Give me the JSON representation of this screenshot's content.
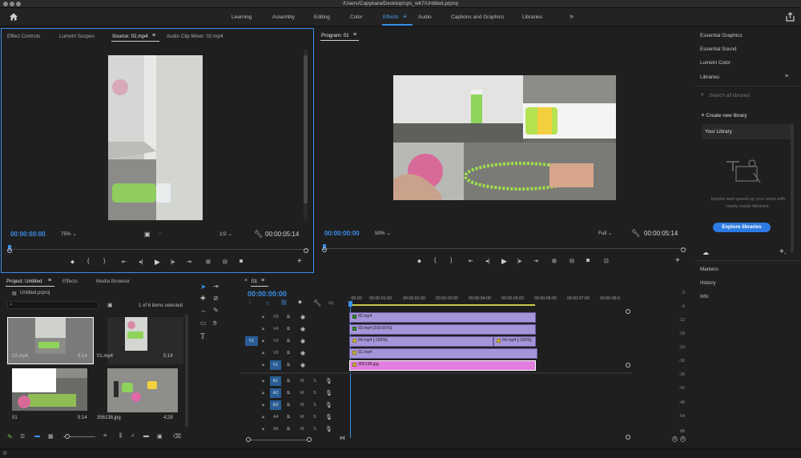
{
  "window": {
    "title": "/Users/Capybara/Desktop/cps_wk7/Untitled.prproj"
  },
  "workspaces": [
    "Learning",
    "Assembly",
    "Editing",
    "Color",
    "Effects",
    "Audio",
    "Captions and Graphics",
    "Libraries"
  ],
  "workspace_active": "Effects",
  "source_panel": {
    "tabs": [
      "Effect Controls",
      "Lumetri Scopes",
      "Source: 02.mp4",
      "Audio Clip Mixer: 02.mp4"
    ],
    "active_tab": "Source: 02.mp4",
    "timecode_in": "00:00:00:00",
    "zoom": "75%",
    "resolution": "1/2",
    "duration": "00:00:05:14"
  },
  "program_panel": {
    "title": "Program: 01",
    "timecode_in": "00:00:00:00",
    "zoom": "50%",
    "resolution": "Full",
    "duration": "00:00:05:14"
  },
  "right_panel": {
    "items_top": [
      "Essential Graphics",
      "Essential Sound",
      "Lumetri Color",
      "Libraries"
    ],
    "search_placeholder": "Search all libraries",
    "create_library": "Create new library",
    "your_library": "Your Library",
    "promo_text": "Inspire and speed up your work with ready-made libraries.",
    "explore_button": "Explore libraries",
    "items_bottom": [
      "Markers",
      "History",
      "Info"
    ]
  },
  "project_panel": {
    "tabs": [
      "Project: Untitled",
      "Effects",
      "Media Browser"
    ],
    "file": "Untitled.prproj",
    "item_count": "1 of 6 items selected",
    "thumbnails": [
      {
        "name": "02.mp4",
        "duration": "5:14"
      },
      {
        "name": "01.mp4",
        "duration": "5:14"
      },
      {
        "name": "01",
        "duration": "5:14"
      },
      {
        "name": "356138.jpg",
        "duration": "4;29"
      }
    ]
  },
  "timeline": {
    "tab": "01",
    "timecode": "00:00:00:00",
    "ruler": [
      ":00:00",
      "00:00:01:00",
      "00:00:02:00",
      "00:00:03:00",
      "00:00:04:00",
      "00:00:05:00",
      "00:00:06:00",
      "00:00:07:00",
      "00:00:08:0"
    ],
    "video_tracks": [
      "V5",
      "V4",
      "V3",
      "V2",
      "V1"
    ],
    "source_patch": "V1",
    "audio_tracks": [
      "A1",
      "A2",
      "A3",
      "A4",
      "A5"
    ],
    "clips": [
      {
        "track": "V5",
        "label": "02.mp4"
      },
      {
        "track": "V4",
        "label": "03.mp4 [169.91%]"
      },
      {
        "track": "V3",
        "label": "04.mp4 [-150%]"
      },
      {
        "track": "V3b",
        "label": "04.mp4 [-150%]"
      },
      {
        "track": "V2",
        "label": "01.mp4"
      },
      {
        "track": "V1",
        "label": "356138.jpg"
      }
    ]
  },
  "audio_meter": {
    "ticks": [
      "0",
      "-6",
      "-12",
      "-18",
      "-24",
      "-30",
      "-36",
      "-42",
      "-48",
      "-54"
    ],
    "bottom": "dB",
    "solo": [
      "S",
      "S"
    ]
  },
  "icons": [
    "home-icon",
    "share-icon",
    "wrench-icon",
    "play-icon",
    "marker-icon",
    "camera-icon",
    "add-icon",
    "selection-tool-icon",
    "pen-icon",
    "hand-icon",
    "type-icon"
  ],
  "colors": {
    "accent": "#3a8fe8",
    "clip_video": "#a594d8",
    "clip_image": "#e07fe0",
    "explore_button": "#2d7be2"
  }
}
